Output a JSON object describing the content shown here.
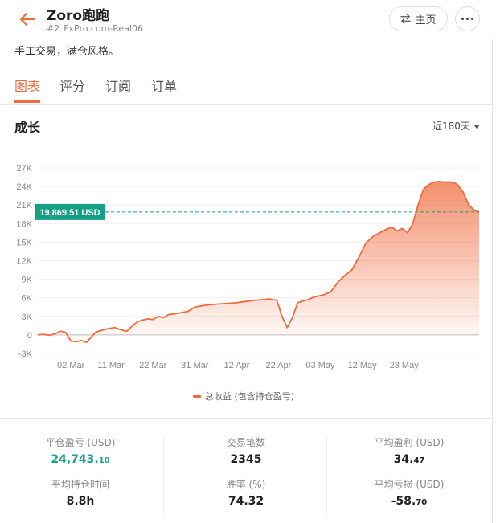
{
  "header": {
    "title": "Zoro跑跑",
    "rank": "#2",
    "account": "FxPro.com-Real06",
    "home_label": "主页"
  },
  "description": "手工交易，满仓风格。",
  "tabs": [
    {
      "label": "图表",
      "active": true
    },
    {
      "label": "评分",
      "active": false
    },
    {
      "label": "订阅",
      "active": false
    },
    {
      "label": "订单",
      "active": false
    }
  ],
  "section": {
    "title": "成长",
    "period": "近180天"
  },
  "colors": {
    "accent": "#f06b3c",
    "marker": "#13a085",
    "positive": "#1aa28e"
  },
  "chart_data": {
    "type": "area",
    "marker_label": "19,869.51 USD",
    "marker_value": 19869.51,
    "ylim": [
      -3000,
      27000
    ],
    "yticks": [
      -3000,
      0,
      3000,
      6000,
      9000,
      12000,
      15000,
      18000,
      21000,
      24000,
      27000
    ],
    "ytick_labels": [
      "-3K",
      "0",
      "3K",
      "6K",
      "9K",
      "12K",
      "15K",
      "18K",
      "21K",
      "24K",
      "27K"
    ],
    "xtick_labels": [
      "02 Mar",
      "11 Mar",
      "22 Mar",
      "31 Mar",
      "12 Apr",
      "22 Apr",
      "03 May",
      "12 May",
      "23 May"
    ],
    "xlim": [
      0,
      18
    ],
    "xtick_positions": [
      1.9,
      4.2,
      6.6,
      9.0,
      11.4,
      13.8,
      16.2,
      18.6,
      21.0
    ],
    "legend": "总收益 (包含持仓盈亏)",
    "series": [
      {
        "name": "总收益 (包含持仓盈亏)",
        "x": [
          0,
          0.3,
          0.7,
          1.0,
          1.3,
          1.6,
          1.9,
          2.2,
          2.5,
          2.8,
          3.0,
          3.3,
          3.6,
          4.0,
          4.4,
          4.8,
          5.1,
          5.4,
          5.7,
          6.0,
          6.3,
          6.6,
          6.9,
          7.2,
          7.5,
          7.8,
          8.2,
          8.6,
          9.0,
          9.4,
          9.9,
          10.4,
          10.9,
          11.4,
          11.9,
          12.4,
          12.9,
          13.3,
          13.7,
          14.0,
          14.3,
          14.6,
          14.9,
          15.2,
          15.5,
          15.8,
          16.1,
          16.4,
          16.8,
          17.2,
          17.6,
          18.0,
          18.4,
          18.8,
          19.2,
          19.6,
          20.0,
          20.3,
          20.6,
          20.9,
          21.2,
          21.5,
          21.8,
          22.1,
          22.4,
          22.7,
          23.0,
          23.3,
          23.6,
          23.9,
          24.1,
          24.4,
          24.7,
          24.9,
          25.1,
          25.3
        ],
        "values": [
          0,
          100,
          -50,
          200,
          600,
          400,
          -1000,
          -1100,
          -900,
          -1200,
          -600,
          400,
          700,
          1000,
          1200,
          800,
          600,
          1400,
          2100,
          2400,
          2600,
          2500,
          3000,
          2800,
          3300,
          3400,
          3600,
          3800,
          4500,
          4700,
          4900,
          5000,
          5100,
          5200,
          5400,
          5600,
          5700,
          5800,
          5600,
          3000,
          1200,
          2800,
          5200,
          5500,
          5700,
          6100,
          6300,
          6500,
          7000,
          8500,
          9600,
          10500,
          12500,
          14800,
          15900,
          16500,
          17100,
          17400,
          16800,
          17200,
          16500,
          18000,
          21000,
          23500,
          24300,
          24700,
          24800,
          24700,
          24743,
          24600,
          24200,
          23000,
          21000,
          20500,
          20000,
          19869.51
        ]
      }
    ]
  },
  "stats": [
    {
      "label": "平仓盈亏 (USD)",
      "int": "24,743.",
      "dec": "10",
      "green": true
    },
    {
      "label": "交易笔数",
      "int": "2345",
      "dec": "",
      "green": false
    },
    {
      "label": "平均盈利 (USD)",
      "int": "34.",
      "dec": "47",
      "green": false
    },
    {
      "label": "平均持仓时间",
      "int": "8.8h",
      "dec": "",
      "green": false
    },
    {
      "label": "胜率 (%)",
      "int": "74.32",
      "dec": "",
      "green": false
    },
    {
      "label": "平均亏损 (USD)",
      "int": "-58.",
      "dec": "70",
      "green": false
    }
  ]
}
